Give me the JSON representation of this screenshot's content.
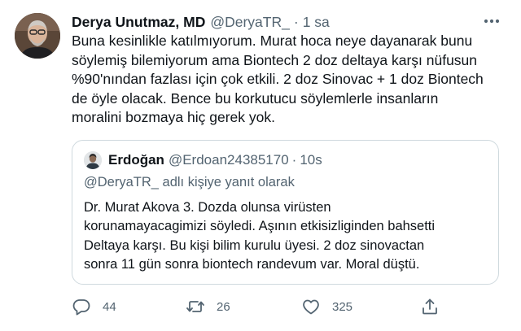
{
  "tweet": {
    "author_name": "Derya Unutmaz, MD",
    "handle": "@DeryaTR_",
    "separator": "·",
    "timestamp": "1 sa",
    "avatar_icon": "profile-photo",
    "more_icon": "more-horizontal-icon",
    "text": "Buna kesinlikle katılmıyorum. Murat hoca neye dayanarak bunu\nsöylemiş bilemiyorum ama Biontech 2 doz deltaya karşı nüfusun\n%90'nından fazlası için çok etkili. 2 doz Sinovac + 1 doz Biontech\nde öyle olacak. Bence bu korkutucu söylemlerle insanların\nmoralini bozmaya hiç gerek yok."
  },
  "quote": {
    "author_name": "Erdoğan",
    "handle": "@Erdoan24385170",
    "separator": "·",
    "timestamp": "10s",
    "reply_context": "@DeryaTR_ adlı kişiye yanıt olarak",
    "text": "Dr. Murat Akova 3. Dozda olunsa virüsten\nkorunamayacagimizi söyledi. Aşının etkisizliginden bahsetti\nDeltaya karşı. Bu kişi bilim kurulu üyesi. 2 doz sinovactan\nsonra 11 gün sonra biontech randevum var. Moral düştü."
  },
  "actions": {
    "reply": {
      "icon": "reply-icon",
      "count": "44"
    },
    "retweet": {
      "icon": "retweet-icon",
      "count": "26"
    },
    "like": {
      "icon": "heart-icon",
      "count": "325"
    },
    "share": {
      "icon": "share-icon"
    }
  },
  "colors": {
    "text": "#0f1419",
    "secondary": "#536471",
    "border": "#cfd9de",
    "background": "#ffffff"
  }
}
